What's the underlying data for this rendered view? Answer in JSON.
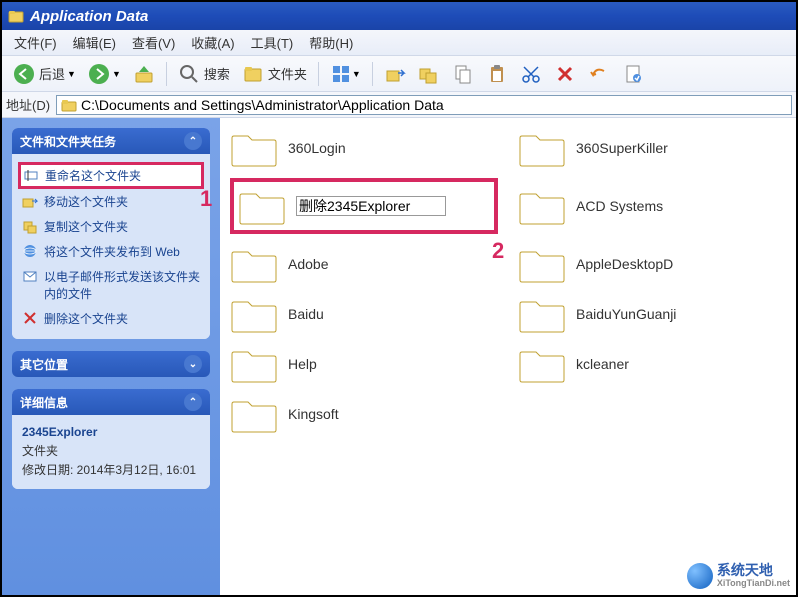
{
  "window": {
    "title": "Application Data"
  },
  "menu": {
    "file": "文件(F)",
    "edit": "编辑(E)",
    "view": "查看(V)",
    "favorites": "收藏(A)",
    "tools": "工具(T)",
    "help": "帮助(H)"
  },
  "toolbar": {
    "back": "后退",
    "search": "搜索",
    "folders": "文件夹"
  },
  "address": {
    "label": "地址(D)",
    "path": "C:\\Documents and Settings\\Administrator\\Application Data"
  },
  "sidebar": {
    "tasks": {
      "title": "文件和文件夹任务",
      "items": [
        {
          "label": "重命名这个文件夹"
        },
        {
          "label": "移动这个文件夹"
        },
        {
          "label": "复制这个文件夹"
        },
        {
          "label": "将这个文件夹发布到 Web"
        },
        {
          "label": "以电子邮件形式发送该文件夹内的文件"
        },
        {
          "label": "删除这个文件夹"
        }
      ]
    },
    "other": {
      "title": "其它位置"
    },
    "details": {
      "title": "详细信息",
      "name": "2345Explorer",
      "type": "文件夹",
      "modified": "修改日期: 2014年3月12日, 16:01"
    }
  },
  "annotations": {
    "one": "1",
    "two": "2"
  },
  "folders": [
    {
      "name": "360Login"
    },
    {
      "name": "360SuperKiller"
    },
    {
      "rename": true,
      "value": "删除2345Explorer"
    },
    {
      "name": "ACD Systems"
    },
    {
      "name": "Adobe"
    },
    {
      "name": "AppleDesktopD"
    },
    {
      "name": "Baidu"
    },
    {
      "name": "BaiduYunGuanji"
    },
    {
      "name": "Help"
    },
    {
      "name": "kcleaner"
    },
    {
      "name": "Kingsoft"
    }
  ],
  "watermark": {
    "line1": "系统天地",
    "line2": "XiTongTianDi.net"
  }
}
